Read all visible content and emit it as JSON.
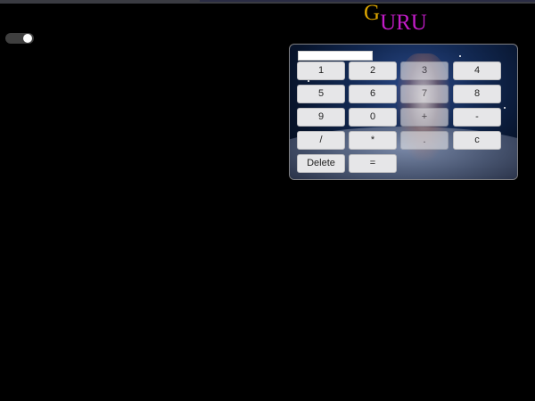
{
  "logo": {
    "first_letter": "G",
    "rest": "URU"
  },
  "colors": {
    "logo_first": "#d8a200",
    "logo_rest": "#c31cc8",
    "background": "#000000",
    "button_bg": "#e6e6e8"
  },
  "theme_toggle": {
    "state": "on"
  },
  "calculator": {
    "display_value": "",
    "buttons": {
      "b1": "1",
      "b2": "2",
      "b3": "3",
      "b4": "4",
      "b5": "5",
      "b6": "6",
      "b7": "7",
      "b8": "8",
      "b9": "9",
      "b0": "0",
      "plus": "+",
      "minus": "-",
      "divide": "/",
      "multiply": "*",
      "dot": ".",
      "clear": "c",
      "delete": "Delete",
      "equals": "="
    }
  }
}
